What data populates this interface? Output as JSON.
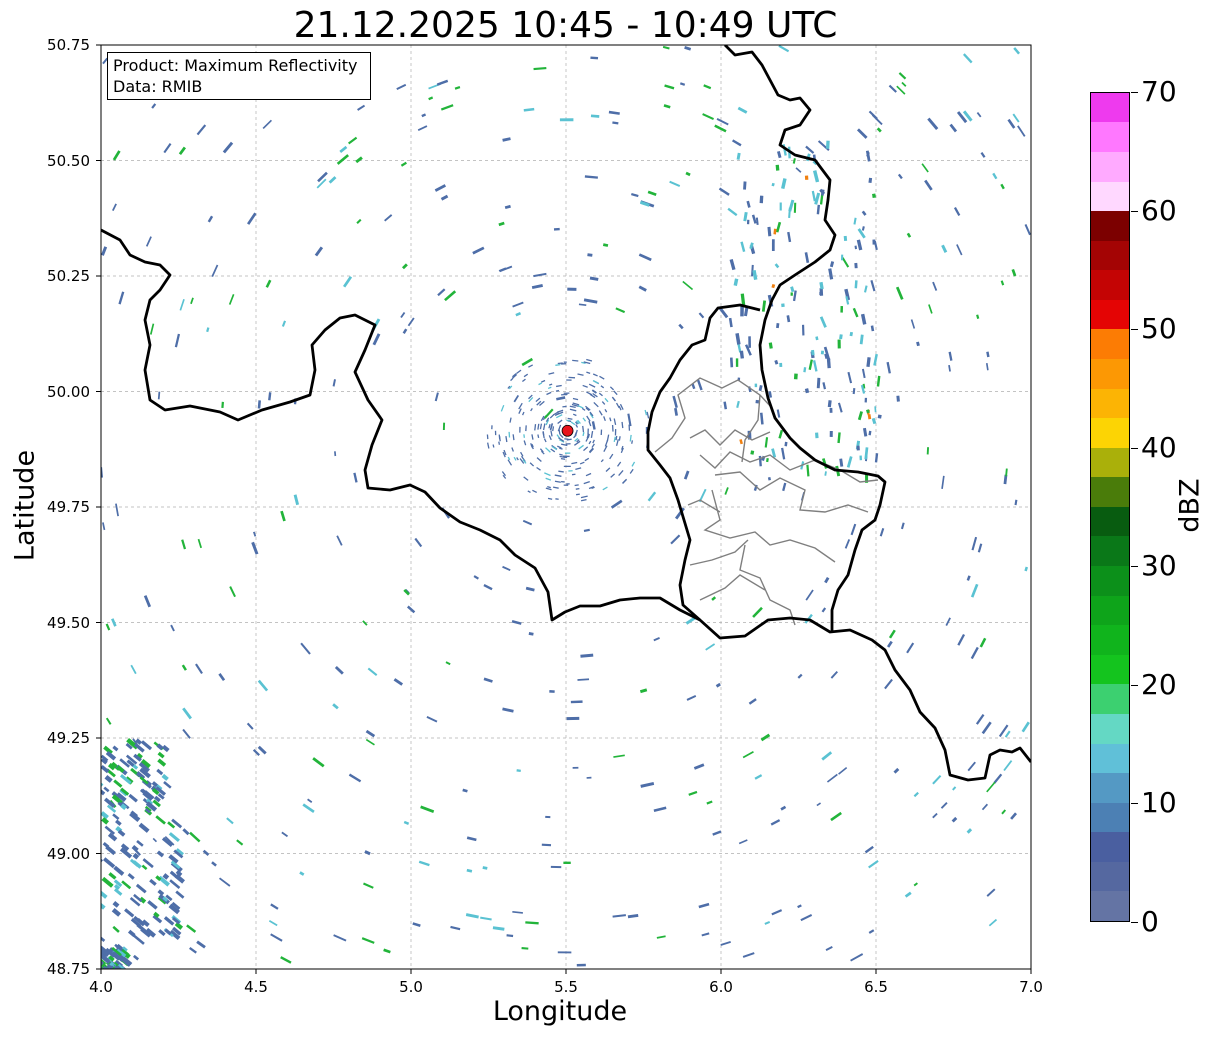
{
  "title": "21.12.2025 10:45 - 10:49 UTC",
  "info": {
    "product": "Product: Maximum Reflectivity",
    "data": "Data: RMIB"
  },
  "axes": {
    "xlabel": "Longitude",
    "ylabel": "Latitude",
    "x_ticks": [
      "4.0",
      "4.5",
      "5.0",
      "5.5",
      "6.0",
      "6.5",
      "7.0"
    ],
    "y_ticks": [
      "50.75",
      "50.50",
      "50.25",
      "50.00",
      "49.75",
      "49.50",
      "49.25",
      "49.00",
      "48.75"
    ],
    "xlim": [
      4.0,
      7.0
    ],
    "ylim": [
      48.75,
      50.75
    ],
    "grid": true
  },
  "radar_site": {
    "lon": 5.505,
    "lat": 49.915,
    "color": "#e8141c"
  },
  "colorbar": {
    "label": "dBZ",
    "range": [
      0,
      70
    ],
    "ticks": [
      "0",
      "10",
      "20",
      "30",
      "40",
      "50",
      "60",
      "70"
    ],
    "colors": [
      "#6474a4",
      "#5568a0",
      "#4a5fa0",
      "#4c80b4",
      "#5499c4",
      "#60c0d8",
      "#64d8c4",
      "#3cd070",
      "#14c41e",
      "#10b41c",
      "#0ea41a",
      "#0c901a",
      "#0a7818",
      "#085c10",
      "#4a7c0a",
      "#aab00a",
      "#fcd404",
      "#fcb404",
      "#fc9804",
      "#fc7c04",
      "#e40404",
      "#c40404",
      "#a40404",
      "#7c0000",
      "#ffd8ff",
      "#ffaaff",
      "#ff78ff",
      "#ee3aee"
    ]
  },
  "map": {
    "land_color": "#ffffff",
    "border_color": "#000000",
    "district_color": "#808080",
    "echo_colors": {
      "weak": "#4e6ea8",
      "light": "#5ac2d2",
      "moderate": "#22b43a",
      "yellow": "#f0d010",
      "orange": "#f08010"
    }
  }
}
